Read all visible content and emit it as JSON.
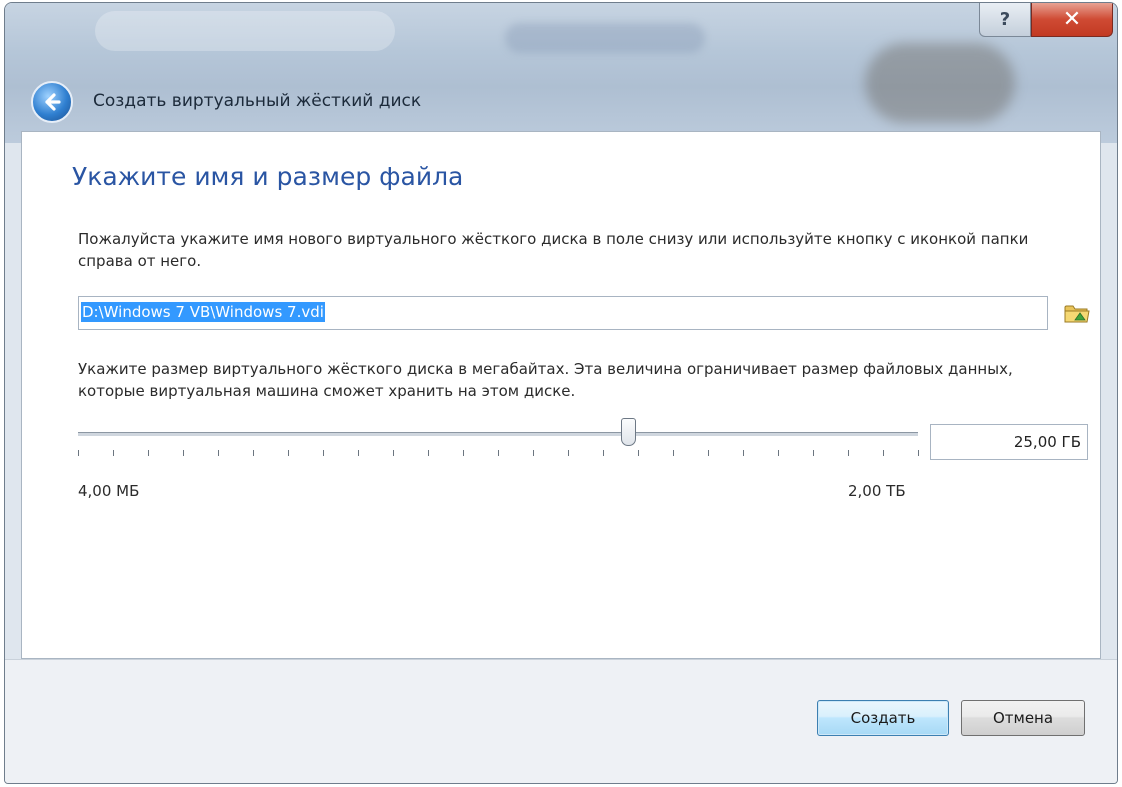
{
  "window": {
    "title": "Создать виртуальный жёсткий диск",
    "help_glyph": "?",
    "close_glyph": "✕"
  },
  "page": {
    "heading": "Укажите имя и размер файла",
    "file_prompt": "Пожалуйста укажите имя нового виртуального жёсткого диска в поле снизу или используйте кнопку с иконкой папки справа от него.",
    "file_path": "D:\\Windows 7 VB\\Windows 7.vdi",
    "size_prompt": "Укажите размер виртуального жёсткого диска в мегабайтах. Эта величина ограничивает размер файловых данных, которые виртуальная машина сможет хранить на этом диске."
  },
  "size": {
    "value": "25,00 ГБ",
    "min_label": "4,00 МБ",
    "max_label": "2,00 ТБ",
    "slider_fraction": 0.655,
    "tick_count": 25
  },
  "buttons": {
    "create": "Создать",
    "cancel": "Отмена"
  },
  "icons": {
    "back": "back-arrow-icon",
    "folder": "folder-icon",
    "help": "help-icon",
    "close": "close-icon"
  }
}
